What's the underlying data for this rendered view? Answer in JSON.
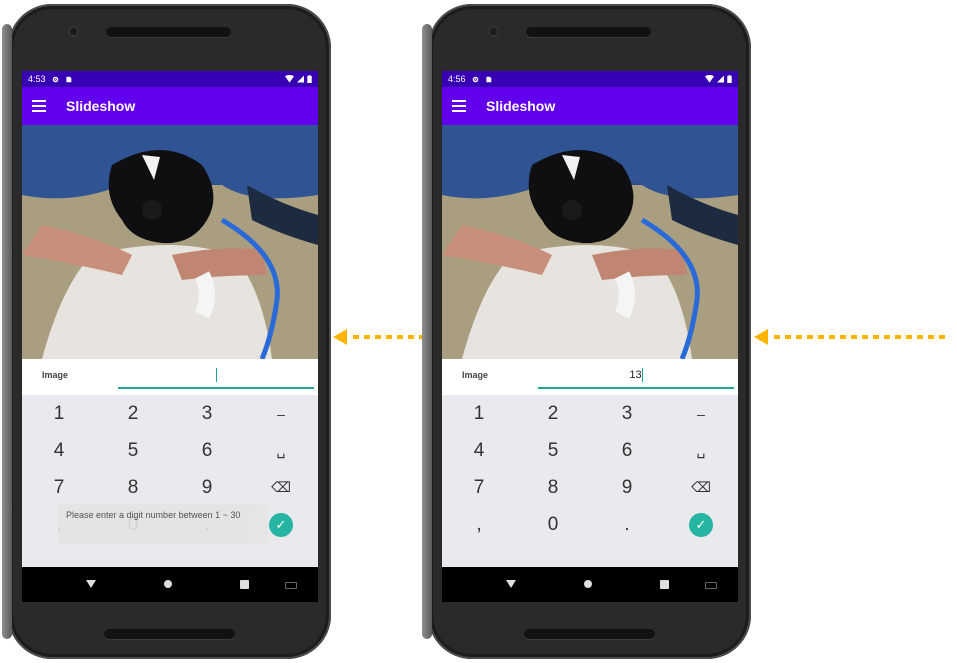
{
  "colors": {
    "status_bar": "#3700b3",
    "app_bar": "#6200ee",
    "accent": "#1aa89a",
    "done_button": "#27b5a3",
    "arrow": "#ffb400"
  },
  "phones": [
    {
      "status_time": "4:53",
      "app_title": "Slideshow",
      "image_label": "Image",
      "input_value": "",
      "keys": [
        "1",
        "2",
        "3",
        "–",
        "4",
        "5",
        "6",
        "␣",
        "7",
        "8",
        "9",
        "⌫",
        ",",
        "0",
        ".",
        "✓"
      ],
      "toast": "Please enter a digit number between 1 ~ 30"
    },
    {
      "status_time": "4:56",
      "app_title": "Slideshow",
      "image_label": "Image",
      "input_value": "13",
      "keys": [
        "1",
        "2",
        "3",
        "–",
        "4",
        "5",
        "6",
        "␣",
        "7",
        "8",
        "9",
        "⌫",
        ",",
        "0",
        ".",
        "✓"
      ],
      "toast": ""
    }
  ],
  "icons": {
    "menu": "hamburger-menu-icon",
    "settings": "gear-icon",
    "sim": "sd-card-icon",
    "wifi": "wifi-icon",
    "signal": "cell-signal-icon",
    "battery": "battery-icon",
    "back": "back-triangle-icon",
    "home": "home-circle-icon",
    "recents": "recents-square-icon",
    "keyboard": "keyboard-icon",
    "arrow": "dotted-arrow-left-icon"
  }
}
